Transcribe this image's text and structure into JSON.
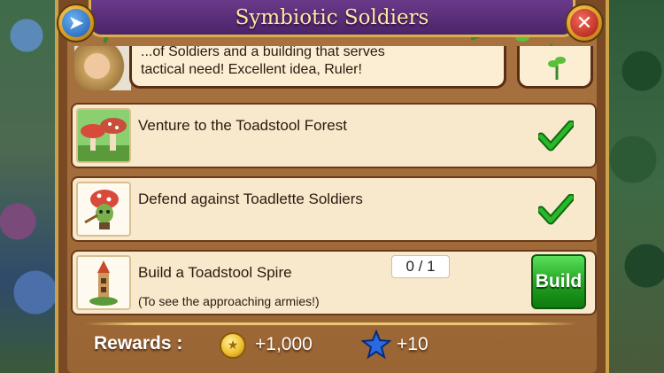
{
  "window": {
    "title": "Symbiotic Soldiers"
  },
  "controls": {
    "back_icon": "back-arrow-icon",
    "close_icon": "close-x-icon"
  },
  "dialog": {
    "text_top": "...of Soldiers and a building that serves",
    "text": "tactical need! Excellent idea, Ruler!"
  },
  "quests": [
    {
      "title": "Venture to the Toadstool Forest",
      "status": "complete",
      "icon": "toadstool-forest-icon"
    },
    {
      "title": "Defend against Toadlette Soldiers",
      "status": "complete",
      "icon": "toadlette-soldier-icon"
    },
    {
      "title": "Build a Toadstool Spire",
      "subtitle": "(To see the approaching armies!)",
      "progress": "0 / 1",
      "button": "Build",
      "icon": "toadstool-spire-icon"
    }
  ],
  "rewards": {
    "label": "Rewards :",
    "coins": "+1,000",
    "stars": "+10"
  },
  "colors": {
    "title_bg": "#5a2e7a",
    "title_text": "#ffe9a0",
    "panel": "#7a4a24",
    "row_bg": "#f8e8cc",
    "build_green": "#20a020",
    "check_green": "#1a9a1a"
  }
}
